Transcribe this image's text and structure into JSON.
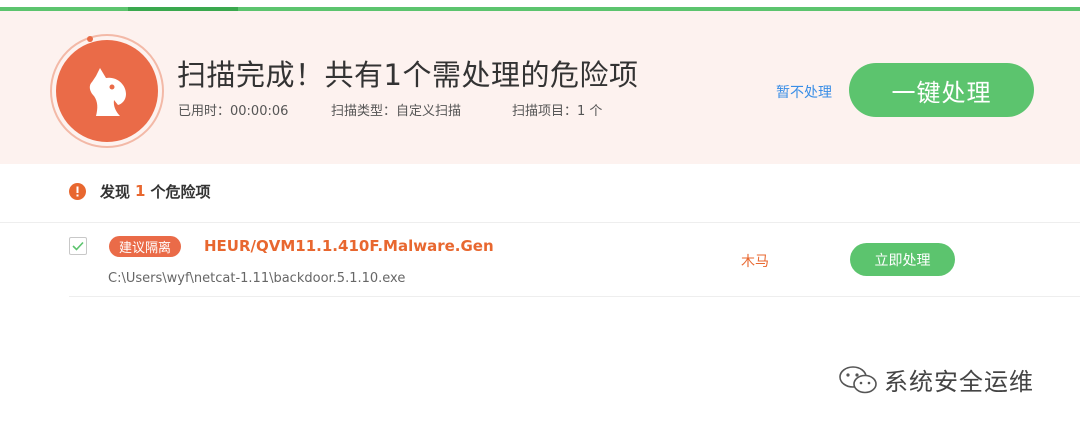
{
  "colors": {
    "accent_green": "#5cc46e",
    "danger_orange": "#ea6b48",
    "link_blue": "#3a8ee6",
    "header_bg": "#fdf2ef"
  },
  "header": {
    "logo_icon": "horse-head-icon",
    "title": "扫描完成！共有1个需处理的危险项",
    "elapsed": "已用时：00:00:06",
    "scan_type": "扫描类型：自定义扫描",
    "scan_items": "扫描项目：1 个",
    "ignore_label": "暂不处理",
    "one_key_label": "一键处理"
  },
  "section": {
    "icon": "warning-icon",
    "prefix": "发现",
    "count": "1",
    "suffix": "个危险项"
  },
  "threats": [
    {
      "checked": true,
      "tag": "建议隔离",
      "name": "HEUR/QVM11.1.410F.Malware.Gen",
      "path": "C:\\Users\\wyf\\netcat-1.11\\backdoor.5.1.10.exe",
      "type": "木马",
      "action_label": "立即处理"
    }
  ],
  "watermark": {
    "icon": "wechat-icon",
    "text": "系统安全运维"
  }
}
